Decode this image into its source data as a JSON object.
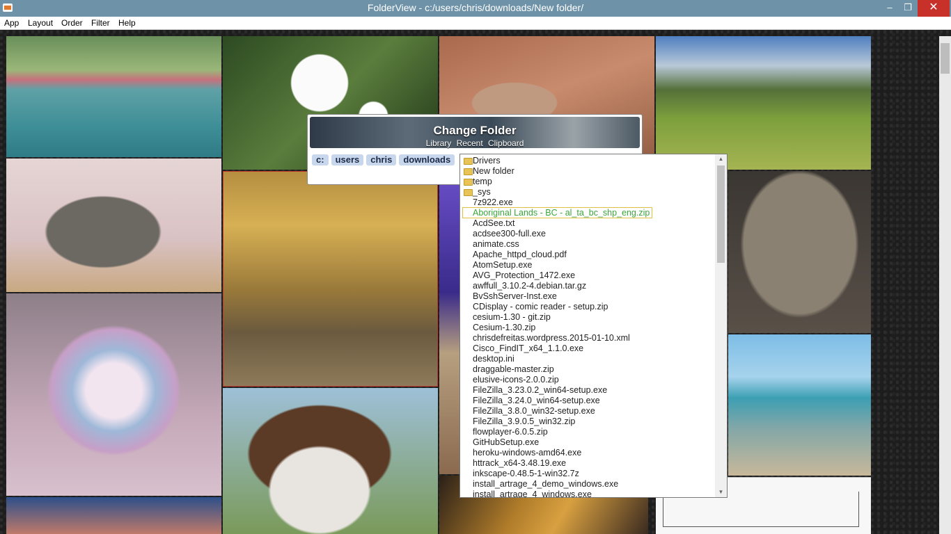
{
  "window": {
    "title": "FolderView - c:/users/chris/downloads/New folder/",
    "minimize": "–",
    "maximize": "❐",
    "close": "✕"
  },
  "menu": [
    "App",
    "Layout",
    "Order",
    "Filter",
    "Help"
  ],
  "dialog": {
    "title": "Change Folder",
    "links": [
      "Library",
      "Recent",
      "Clipboard"
    ],
    "crumbs": [
      "c:",
      "users",
      "chris",
      "downloads"
    ]
  },
  "files": [
    {
      "name": "Drivers",
      "type": "folder"
    },
    {
      "name": "New folder",
      "type": "folder"
    },
    {
      "name": "temp",
      "type": "folder"
    },
    {
      "name": "_sys",
      "type": "folder"
    },
    {
      "name": "7z922.exe",
      "type": "file"
    },
    {
      "name": "Aboriginal Lands - BC - al_ta_bc_shp_eng.zip",
      "type": "file",
      "selected": true
    },
    {
      "name": "AcdSee.txt",
      "type": "file"
    },
    {
      "name": "acdsee300-full.exe",
      "type": "file"
    },
    {
      "name": "animate.css",
      "type": "file"
    },
    {
      "name": "Apache_httpd_cloud.pdf",
      "type": "file"
    },
    {
      "name": "AtomSetup.exe",
      "type": "file"
    },
    {
      "name": "AVG_Protection_1472.exe",
      "type": "file"
    },
    {
      "name": "awffull_3.10.2-4.debian.tar.gz",
      "type": "file"
    },
    {
      "name": "BvSshServer-Inst.exe",
      "type": "file"
    },
    {
      "name": "CDisplay - comic reader - setup.zip",
      "type": "file"
    },
    {
      "name": "cesium-1.30 - git.zip",
      "type": "file"
    },
    {
      "name": "Cesium-1.30.zip",
      "type": "file"
    },
    {
      "name": "chrisdefreitas.wordpress.2015-01-10.xml",
      "type": "file"
    },
    {
      "name": "Cisco_FindIT_x64_1.1.0.exe",
      "type": "file"
    },
    {
      "name": "desktop.ini",
      "type": "file"
    },
    {
      "name": "draggable-master.zip",
      "type": "file"
    },
    {
      "name": "elusive-icons-2.0.0.zip",
      "type": "file"
    },
    {
      "name": "FileZilla_3.23.0.2_win64-setup.exe",
      "type": "file"
    },
    {
      "name": "FileZilla_3.24.0_win64-setup.exe",
      "type": "file"
    },
    {
      "name": "FileZilla_3.8.0_win32-setup.exe",
      "type": "file"
    },
    {
      "name": "FileZilla_3.9.0.5_win32.zip",
      "type": "file"
    },
    {
      "name": "flowplayer-6.0.5.zip",
      "type": "file"
    },
    {
      "name": "GitHubSetup.exe",
      "type": "file"
    },
    {
      "name": "heroku-windows-amd64.exe",
      "type": "file"
    },
    {
      "name": "httrack_x64-3.48.19.exe",
      "type": "file"
    },
    {
      "name": "inkscape-0.48.5-1-win32.7z",
      "type": "file"
    },
    {
      "name": "install_artrage_4_demo_windows.exe",
      "type": "file"
    },
    {
      "name": "install_artrage_4_windows.exe",
      "type": "file"
    }
  ],
  "scroll": {
    "up": "▲",
    "down": "▼"
  }
}
